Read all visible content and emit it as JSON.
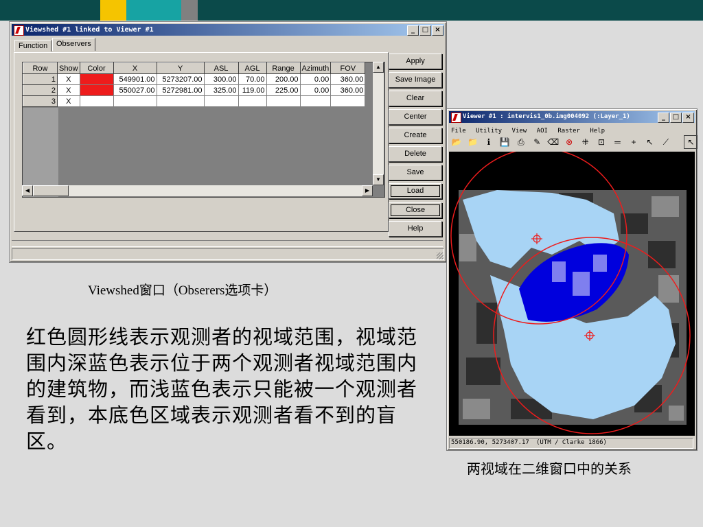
{
  "viewshed_window": {
    "title": "Viewshed #1 linked to Viewer #1",
    "tabs": [
      {
        "label": "Function"
      },
      {
        "label": "Observers"
      }
    ],
    "table": {
      "headers": [
        "Row",
        "Show",
        "Color",
        "X",
        "Y",
        "ASL",
        "AGL",
        "Range",
        "Azimuth",
        "FOV"
      ],
      "rows": [
        {
          "row": "1",
          "show": "X",
          "color": "#ee1c1c",
          "x": "549901.00",
          "y": "5273207.00",
          "asl": "300.00",
          "agl": "70.00",
          "range": "200.00",
          "azimuth": "0.00",
          "fov": "360.00"
        },
        {
          "row": "2",
          "show": "X",
          "color": "#ee1c1c",
          "x": "550027.00",
          "y": "5272981.00",
          "asl": "325.00",
          "agl": "119.00",
          "range": "225.00",
          "azimuth": "0.00",
          "fov": "360.00"
        },
        {
          "row": "3",
          "show": "X",
          "color": "",
          "x": "",
          "y": "",
          "asl": "",
          "agl": "",
          "range": "",
          "azimuth": "",
          "fov": ""
        }
      ]
    },
    "buttons": {
      "apply": "Apply",
      "save_image": "Save Image",
      "clear": "Clear",
      "center": "Center",
      "create": "Create",
      "delete": "Delete",
      "save": "Save",
      "load": "Load",
      "close": "Close",
      "help": "Help"
    }
  },
  "viewer_window": {
    "title": "Viewer #1 : intervis1_0b.img004092 (:Layer_1)",
    "menu": [
      "File",
      "Utility",
      "View",
      "AOI",
      "Raster",
      "Help"
    ],
    "status_coords": "550186.90, 5273407.17",
    "status_projection": "(UTM / Clarke 1866)"
  },
  "captions": {
    "viewshed_caption": "Viewshed窗口（Obserers选项卡）",
    "description": "红色圆形线表示观测者的视域范围，视域范围内深蓝色表示位于两个观测者视域范围内的建筑物，而浅蓝色表示只能被一个观测者看到，本底色区域表示观测者看不到的盲区。",
    "viewer_caption": "两视域在二维窗口中的关系"
  },
  "colors": {
    "header_bar": "#0b4a4a",
    "accent_yellow": "#f5c400",
    "accent_teal": "#17a3a3",
    "accent_gray": "#808080",
    "observer_red": "#ee1c1c",
    "dual_visible": "#0000dd",
    "single_visible": "#a8d4f5"
  }
}
